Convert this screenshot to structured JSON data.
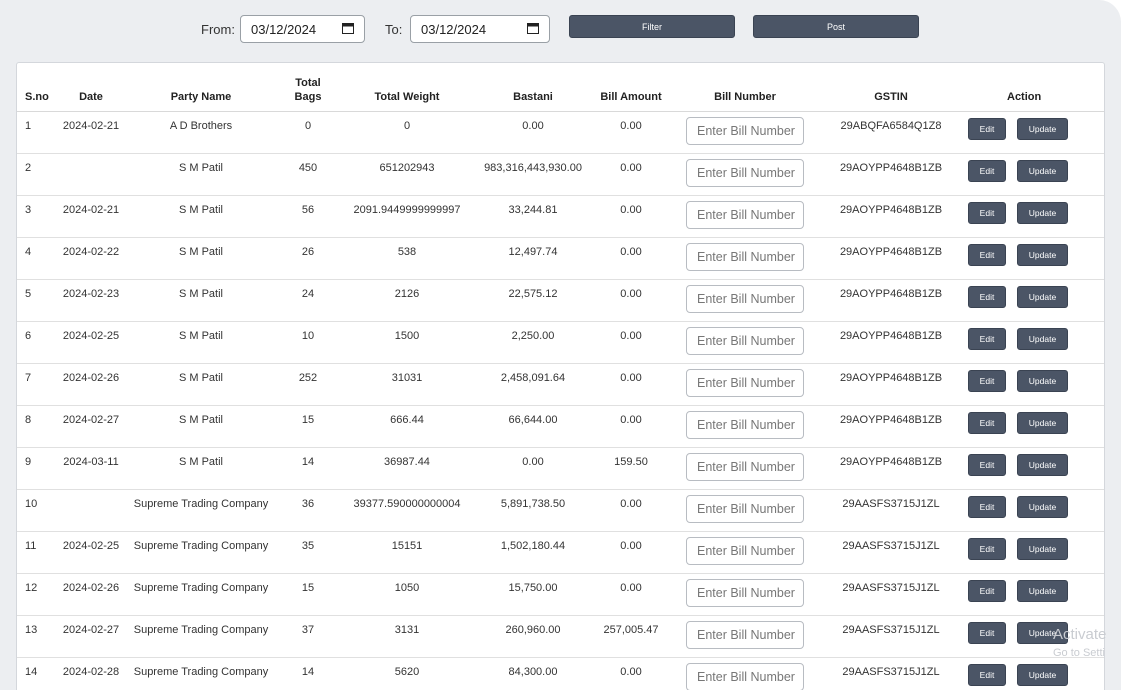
{
  "filters": {
    "from_label": "From:",
    "from_value": "03/12/2024",
    "to_label": "To:",
    "to_value": "03/12/2024",
    "filter_label": "Filter",
    "post_label": "Post"
  },
  "table": {
    "headers": {
      "sno": "S.no",
      "date": "Date",
      "party": "Party Name",
      "bags": "Total Bags",
      "weight": "Total Weight",
      "bastani": "Bastani",
      "amount": "Bill Amount",
      "billno": "Bill Number",
      "gstin": "GSTIN",
      "action": "Action"
    },
    "bill_placeholder": "Enter Bill Number",
    "edit_label": "Edit",
    "update_label": "Update",
    "rows": [
      {
        "sno": "1",
        "date": "2024-02-21",
        "party": "A D Brothers",
        "bags": "0",
        "weight": "0",
        "bastani": "0.00",
        "amount": "0.00",
        "gstin": "29ABQFA6584Q1Z8"
      },
      {
        "sno": "2",
        "date": "",
        "party": "S M Patil",
        "bags": "450",
        "weight": "651202943",
        "bastani": "983,316,443,930.00",
        "amount": "0.00",
        "gstin": "29AOYPP4648B1ZB"
      },
      {
        "sno": "3",
        "date": "2024-02-21",
        "party": "S M Patil",
        "bags": "56",
        "weight": "2091.9449999999997",
        "bastani": "33,244.81",
        "amount": "0.00",
        "gstin": "29AOYPP4648B1ZB"
      },
      {
        "sno": "4",
        "date": "2024-02-22",
        "party": "S M Patil",
        "bags": "26",
        "weight": "538",
        "bastani": "12,497.74",
        "amount": "0.00",
        "gstin": "29AOYPP4648B1ZB"
      },
      {
        "sno": "5",
        "date": "2024-02-23",
        "party": "S M Patil",
        "bags": "24",
        "weight": "2126",
        "bastani": "22,575.12",
        "amount": "0.00",
        "gstin": "29AOYPP4648B1ZB"
      },
      {
        "sno": "6",
        "date": "2024-02-25",
        "party": "S M Patil",
        "bags": "10",
        "weight": "1500",
        "bastani": "2,250.00",
        "amount": "0.00",
        "gstin": "29AOYPP4648B1ZB"
      },
      {
        "sno": "7",
        "date": "2024-02-26",
        "party": "S M Patil",
        "bags": "252",
        "weight": "31031",
        "bastani": "2,458,091.64",
        "amount": "0.00",
        "gstin": "29AOYPP4648B1ZB"
      },
      {
        "sno": "8",
        "date": "2024-02-27",
        "party": "S M Patil",
        "bags": "15",
        "weight": "666.44",
        "bastani": "66,644.00",
        "amount": "0.00",
        "gstin": "29AOYPP4648B1ZB"
      },
      {
        "sno": "9",
        "date": "2024-03-11",
        "party": "S M Patil",
        "bags": "14",
        "weight": "36987.44",
        "bastani": "0.00",
        "amount": "159.50",
        "gstin": "29AOYPP4648B1ZB"
      },
      {
        "sno": "10",
        "date": "",
        "party": "Supreme Trading Company",
        "bags": "36",
        "weight": "39377.590000000004",
        "bastani": "5,891,738.50",
        "amount": "0.00",
        "gstin": "29AASFS3715J1ZL"
      },
      {
        "sno": "11",
        "date": "2024-02-25",
        "party": "Supreme Trading Company",
        "bags": "35",
        "weight": "15151",
        "bastani": "1,502,180.44",
        "amount": "0.00",
        "gstin": "29AASFS3715J1ZL"
      },
      {
        "sno": "12",
        "date": "2024-02-26",
        "party": "Supreme Trading Company",
        "bags": "15",
        "weight": "1050",
        "bastani": "15,750.00",
        "amount": "0.00",
        "gstin": "29AASFS3715J1ZL"
      },
      {
        "sno": "13",
        "date": "2024-02-27",
        "party": "Supreme Trading Company",
        "bags": "37",
        "weight": "3131",
        "bastani": "260,960.00",
        "amount": "257,005.47",
        "gstin": "29AASFS3715J1ZL"
      },
      {
        "sno": "14",
        "date": "2024-02-28",
        "party": "Supreme Trading Company",
        "bags": "14",
        "weight": "5620",
        "bastani": "84,300.00",
        "amount": "0.00",
        "gstin": "29AASFS3715J1ZL"
      }
    ]
  },
  "watermark": {
    "line1": "Activate",
    "line2": "Go to Setti"
  }
}
